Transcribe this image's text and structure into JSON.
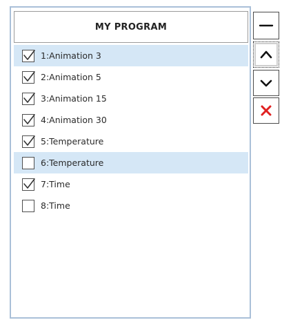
{
  "program": {
    "title": "MY PROGRAM",
    "items": [
      {
        "label": "1:Animation 3",
        "checked": true,
        "highlighted": true
      },
      {
        "label": "2:Animation 5",
        "checked": true,
        "highlighted": false
      },
      {
        "label": "3:Animation 15",
        "checked": true,
        "highlighted": false
      },
      {
        "label": "4:Animation 30",
        "checked": true,
        "highlighted": false
      },
      {
        "label": "5:Temperature",
        "checked": true,
        "highlighted": false
      },
      {
        "label": "6:Temperature",
        "checked": false,
        "highlighted": true
      },
      {
        "label": "7:Time",
        "checked": true,
        "highlighted": false
      },
      {
        "label": "8:Time",
        "checked": false,
        "highlighted": false
      }
    ]
  },
  "toolbar": {
    "buttons": [
      {
        "name": "remove-button",
        "icon": "minus-icon"
      },
      {
        "name": "move-up-button",
        "icon": "chevron-up-icon"
      },
      {
        "name": "move-down-button",
        "icon": "chevron-down-icon"
      },
      {
        "name": "delete-button",
        "icon": "close-icon"
      }
    ]
  },
  "colors": {
    "selection": "#d5e7f6",
    "panel_border": "#a9bfd8",
    "delete_icon": "#e02020"
  }
}
